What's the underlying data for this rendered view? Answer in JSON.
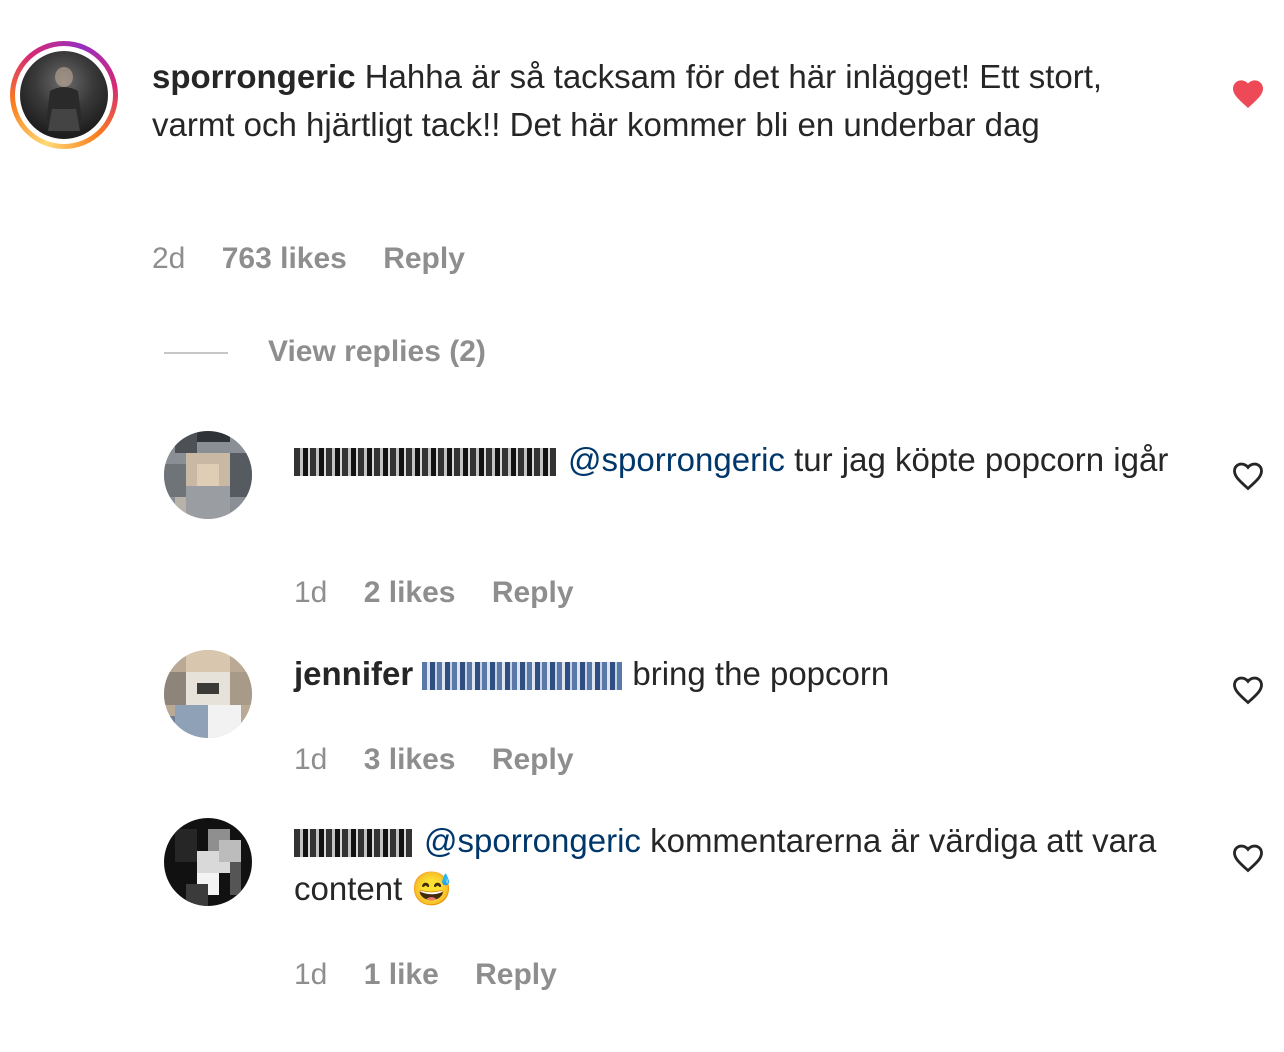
{
  "main_comment": {
    "username": "sporrongeric",
    "text": "Hahha är så tacksam för det här inlägget! Ett stort, varmt och hjärtligt tack!! Det här kommer bli en underbar dag",
    "time": "2d",
    "likes": "763 likes",
    "reply": "Reply",
    "liked": true
  },
  "view_replies": "View replies (2)",
  "replies": [
    {
      "mention": "@sporrongeric",
      "text": " tur jag köpte popcorn igår",
      "time": "1d",
      "likes": "2 likes",
      "reply": "Reply"
    },
    {
      "username": "jennifer",
      "text": "bring the popcorn",
      "time": "1d",
      "likes": "3 likes",
      "reply": "Reply"
    },
    {
      "mention": "@sporrongeric",
      "text": " kommentarerna är värdiga att vara content 😅",
      "time": "1d",
      "likes": "1 like",
      "reply": "Reply"
    }
  ],
  "colors": {
    "text": "#262626",
    "meta": "#8e8e8e",
    "mention": "#00376b",
    "liked_heart": "#ed4956"
  },
  "icons": [
    "heart-filled-icon",
    "heart-outline-icon"
  ]
}
